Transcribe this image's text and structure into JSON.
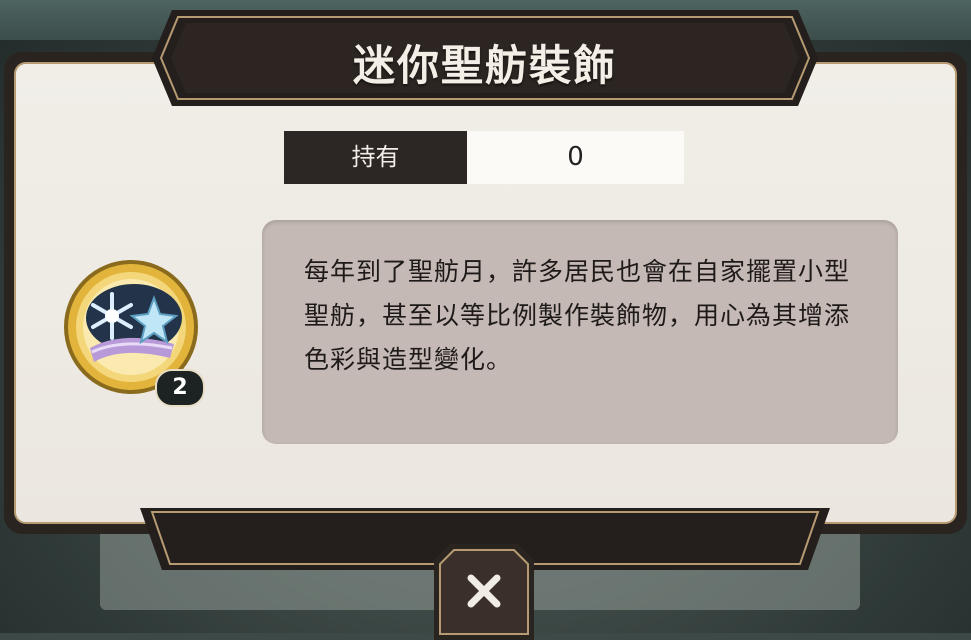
{
  "dialog": {
    "title": "迷你聖舫裝飾",
    "holdings": {
      "label": "持有",
      "value": "0"
    },
    "description": "每年到了聖舫月，許多居民也會在自家擺置小型聖舫，甚至以等比例製作裝飾物，用心為其增添色彩與造型變化。",
    "item": {
      "icon": "snowflake-star-medal-icon",
      "badge": "2"
    },
    "close": {
      "icon": "close-x-icon"
    }
  },
  "colors": {
    "frame": "#2a2421",
    "panel": "#eeebe4",
    "gold_trim": "#b59a72",
    "desc_bg": "#c4b9b4",
    "medal_gold": "#e2b43c"
  }
}
